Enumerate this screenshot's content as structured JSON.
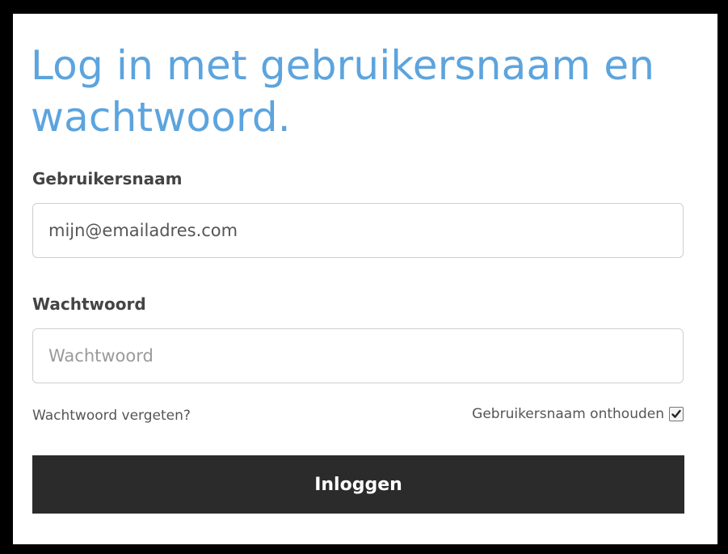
{
  "login_form": {
    "title": "Log in met gebruikersnaam en wachtwoord.",
    "username": {
      "label": "Gebruikersnaam",
      "value": "mijn@emailadres.com"
    },
    "password": {
      "label": "Wachtwoord",
      "placeholder": "Wachtwoord"
    },
    "forgot_link": "Wachtwoord vergeten?",
    "remember": {
      "label": "Gebruikersnaam onthouden",
      "checked": true,
      "icon": "checkmark-icon"
    },
    "submit_label": "Inloggen"
  },
  "colors": {
    "title": "#5ca4de",
    "button_background": "#2b2b2b",
    "button_text": "#ffffff",
    "frame": "#000000"
  }
}
